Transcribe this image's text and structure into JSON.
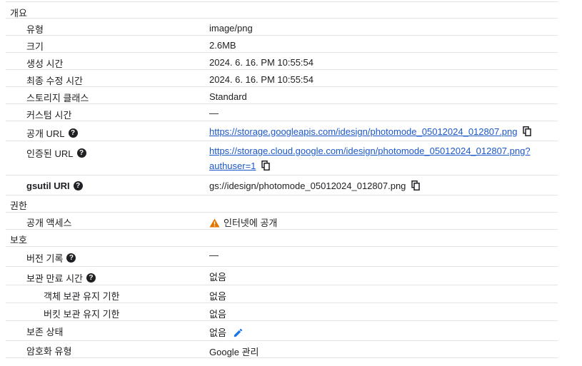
{
  "sections": {
    "overview": "개요",
    "permissions": "권한",
    "protection": "보호"
  },
  "overview": {
    "type_label": "유형",
    "type_value": "image/png",
    "size_label": "크기",
    "size_value": "2.6MB",
    "created_label": "생성 시간",
    "created_value": "2024. 6. 16. PM 10:55:54",
    "modified_label": "최종 수정 시간",
    "modified_value": "2024. 6. 16. PM 10:55:54",
    "storage_class_label": "스토리지 클래스",
    "storage_class_value": "Standard",
    "custom_time_label": "커스텀 시간",
    "custom_time_value": "—",
    "public_url_label": "공개 URL",
    "public_url_value": "https://storage.googleapis.com/idesign/photomode_05012024_012807.png",
    "auth_url_label": "인증된 URL",
    "auth_url_line1": "https://storage.cloud.google.com/idesign/photomode_05012024_012807.png?",
    "auth_url_line2": "authuser=1",
    "gsutil_label": "gsutil URI",
    "gsutil_value": "gs://idesign/photomode_05012024_012807.png"
  },
  "permissions": {
    "public_access_label": "공개 액세스",
    "public_access_value": "인터넷에 공개"
  },
  "protection": {
    "versioning_label": "버전 기록",
    "versioning_value": "—",
    "retention_label": "보관 만료 시간",
    "retention_value": "없음",
    "object_retention_label": "객체 보관 유지 기한",
    "object_retention_value": "없음",
    "bucket_retention_label": "버킷 보관 유지 기한",
    "bucket_retention_value": "없음",
    "hold_label": "보존 상태",
    "hold_value": "없음",
    "encryption_label": "암호화 유형",
    "encryption_value": "Google 관리"
  },
  "icons": {
    "help": "?",
    "help_icon_name": "help-circle-icon",
    "copy_icon_name": "copy-icon",
    "warning_icon_name": "warning-icon",
    "edit_icon_name": "edit-pencil-icon"
  },
  "colors": {
    "link": "#1a57c9",
    "warning": "#e37400",
    "edit": "#1a73e8",
    "divider": "#e3e3e3"
  }
}
